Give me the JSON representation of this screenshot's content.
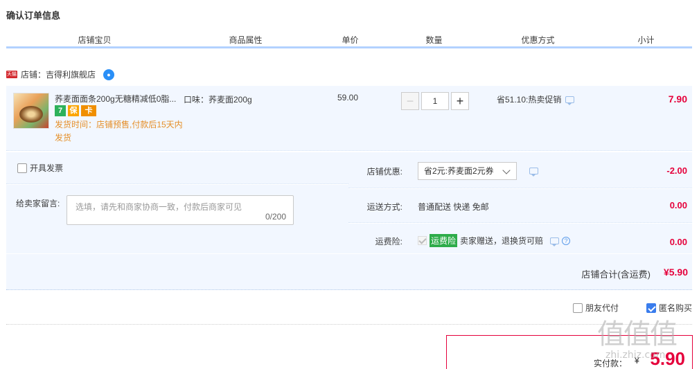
{
  "page": {
    "title": "确认订单信息"
  },
  "columns": [
    "店铺宝贝",
    "商品属性",
    "单价",
    "数量",
    "优惠方式",
    "小计"
  ],
  "shop": {
    "badge": "天猫",
    "name_label": "店铺：吉得利旗舰店"
  },
  "item": {
    "name": "荞麦面面条200g无糖精减低0脂...",
    "badges": [
      "7",
      "保",
      "卡"
    ],
    "ship_time": "发货时间：店铺预售,付款后15天内发货",
    "attribute": "口味：荞麦面200g",
    "unit_price": "59.00",
    "quantity": "1",
    "minus": "−",
    "plus": "+",
    "promotion": "省51.10:热卖促销",
    "subtotal": "7.90"
  },
  "invoice": {
    "label": "开具发票",
    "checked": false
  },
  "message": {
    "label": "给卖家留言:",
    "placeholder": "选填，请先和商家协商一致，付款后商家可见",
    "counter": "0/200"
  },
  "shop_discount": {
    "label": "店铺优惠:",
    "selected": "省2元:荞麦面2元券",
    "amount": "-2.00"
  },
  "shipping": {
    "label": "运送方式:",
    "value": "普通配送 快递 免邮",
    "amount": "0.00"
  },
  "insurance": {
    "label": "运费险:",
    "tag": "运费险",
    "value": "卖家赠送，退换货可赔",
    "help": "?",
    "amount": "0.00"
  },
  "shop_total": {
    "label": "店铺合计(含运费)",
    "amount": "¥5.90"
  },
  "options": {
    "friend_pay": {
      "label": "朋友代付",
      "checked": false
    },
    "anonymous": {
      "label": "匿名购买",
      "checked": true
    }
  },
  "payment": {
    "label": "实付款：",
    "currency": "¥",
    "amount": "5.90"
  },
  "watermark": {
    "text": "值值值",
    "url": "zhi.zhiz.com"
  },
  "colors": {
    "accent": "#e5003b",
    "row_bg": "#f2f7ff",
    "header_line": "#b2d1ff"
  }
}
